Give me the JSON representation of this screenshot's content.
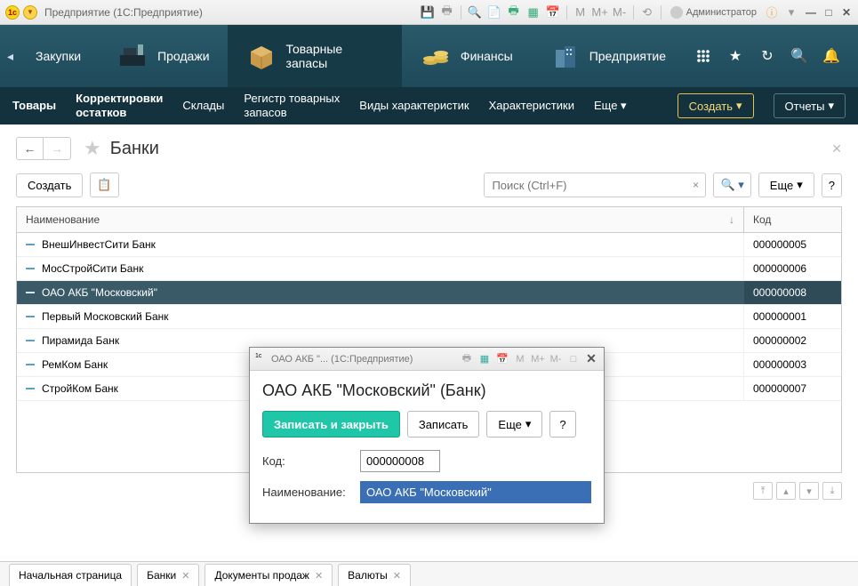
{
  "titlebar": {
    "title": "Предприятие  (1С:Предприятие)",
    "admin_label": "Администратор"
  },
  "mainnav": {
    "sections": [
      {
        "label": "Закупки"
      },
      {
        "label": "Продажи"
      },
      {
        "label": "Товарные запасы"
      },
      {
        "label": "Финансы"
      },
      {
        "label": "Предприятие"
      }
    ]
  },
  "subnav": {
    "items": [
      "Товары",
      "Корректировки\nостатков",
      "Склады",
      "Регистр товарных\nзапасов",
      "Виды характеристик",
      "Характеристики"
    ],
    "more": "Еще",
    "create": "Создать",
    "reports": "Отчеты"
  },
  "page": {
    "title": "Банки",
    "create": "Создать",
    "search_placeholder": "Поиск (Ctrl+F)",
    "more": "Еще",
    "help": "?",
    "columns": {
      "name": "Наименование",
      "code": "Код"
    },
    "rows": [
      {
        "name": "ВнешИнвестСити Банк",
        "code": "000000005"
      },
      {
        "name": "МосСтройСити Банк",
        "code": "000000006"
      },
      {
        "name": "ОАО АКБ \"Московский\"",
        "code": "000000008",
        "selected": true
      },
      {
        "name": "Первый Московский Банк",
        "code": "000000001"
      },
      {
        "name": "Пирамида Банк",
        "code": "000000002"
      },
      {
        "name": "РемКом Банк",
        "code": "000000003"
      },
      {
        "name": "СтройКом Банк",
        "code": "000000007"
      }
    ]
  },
  "tabs": [
    {
      "label": "Начальная страница",
      "closable": false
    },
    {
      "label": "Банки",
      "closable": true
    },
    {
      "label": "Документы продаж",
      "closable": true
    },
    {
      "label": "Валюты",
      "closable": true
    }
  ],
  "dialog": {
    "window_title": "ОАО АКБ \"...  (1С:Предприятие)",
    "title": "ОАО АКБ \"Московский\" (Банк)",
    "save_close": "Записать и закрыть",
    "save": "Записать",
    "more": "Еще",
    "help": "?",
    "code_label": "Код:",
    "code_value": "000000008",
    "name_label": "Наименование:",
    "name_value": "ОАО АКБ \"Московский\""
  },
  "m_labels": {
    "m": "M",
    "mp": "M+",
    "mm": "M-"
  }
}
